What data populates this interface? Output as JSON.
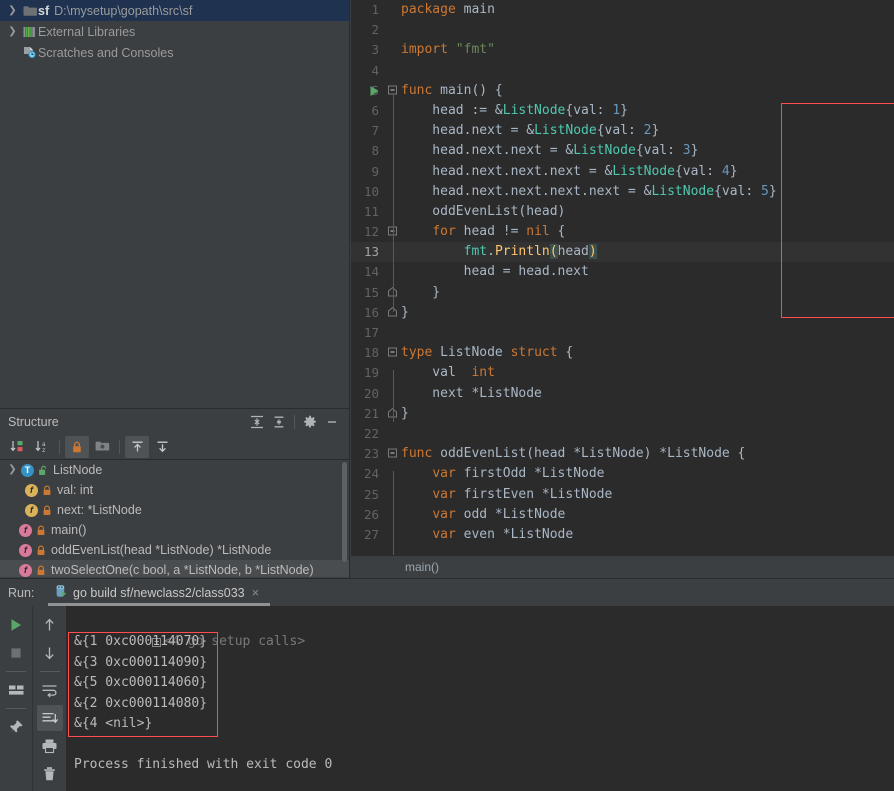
{
  "project_tree": {
    "items": [
      {
        "label_bold": "sf",
        "path": "D:\\mysetup\\gopath\\src\\sf",
        "icon": "folder-icon",
        "arrow": "›",
        "selected": true,
        "indent": 0
      },
      {
        "label_bold": "",
        "path": "External Libraries",
        "icon": "library-icon",
        "arrow": "›",
        "selected": false,
        "indent": 0
      },
      {
        "label_bold": "",
        "path": "Scratches and Consoles",
        "icon": "scratches-icon",
        "arrow": "",
        "selected": false,
        "indent": 0
      }
    ]
  },
  "structure": {
    "title": "Structure",
    "header_buttons": [
      {
        "name": "expand-all-icon"
      },
      {
        "name": "collapse-all-icon"
      },
      {
        "name": "gear-icon"
      },
      {
        "name": "hide-icon"
      }
    ],
    "toolbar_buttons": [
      {
        "name": "sort-by-visibility-icon",
        "active": false
      },
      {
        "name": "sort-alphabetically-icon",
        "active": false
      },
      {
        "name": "show-non-public-icon",
        "active": true
      },
      {
        "name": "group-icon",
        "active": false
      },
      {
        "name": "expand-node-icon",
        "active": true
      },
      {
        "name": "collapse-node-icon",
        "active": false
      }
    ],
    "items": [
      {
        "label": "ListNode",
        "kind": "T",
        "lock": "unlocked",
        "indent": 0,
        "expanded": true
      },
      {
        "label": "val: int",
        "kind": "f",
        "lock": "locked",
        "indent": 1,
        "expanded": null
      },
      {
        "label": "next: *ListNode",
        "kind": "f",
        "lock": "locked",
        "indent": 1,
        "expanded": null
      },
      {
        "label": "main()",
        "kind": "func",
        "lock": "locked",
        "indent": 0,
        "expanded": null
      },
      {
        "label": "oddEvenList(head *ListNode) *ListNode",
        "kind": "func",
        "lock": "locked",
        "indent": 0,
        "expanded": null
      },
      {
        "label": "twoSelectOne(c bool, a *ListNode, b *ListNode)",
        "kind": "func",
        "lock": "locked",
        "indent": 0,
        "expanded": null
      }
    ]
  },
  "editor": {
    "breadcrumb": "main()",
    "highlighted_line": 13,
    "run_arrow_line": 5,
    "lines": [
      {
        "n": 1,
        "tokens": [
          {
            "t": "package",
            "c": "kw"
          },
          {
            "t": " main",
            "c": "ident"
          }
        ]
      },
      {
        "n": 2,
        "tokens": []
      },
      {
        "n": 3,
        "tokens": [
          {
            "t": "import",
            "c": "kw"
          },
          {
            "t": " ",
            "c": "ident"
          },
          {
            "t": "\"fmt\"",
            "c": "str"
          }
        ]
      },
      {
        "n": 4,
        "tokens": []
      },
      {
        "n": 5,
        "tokens": [
          {
            "t": "func",
            "c": "kw"
          },
          {
            "t": " main() {",
            "c": "ident"
          }
        ]
      },
      {
        "n": 6,
        "tokens": [
          {
            "t": "    head := &",
            "c": "ident"
          },
          {
            "t": "ListNode",
            "c": "type"
          },
          {
            "t": "{val: ",
            "c": "ident"
          },
          {
            "t": "1",
            "c": "num"
          },
          {
            "t": "}",
            "c": "ident"
          }
        ]
      },
      {
        "n": 7,
        "tokens": [
          {
            "t": "    head.next = &",
            "c": "ident"
          },
          {
            "t": "ListNode",
            "c": "type"
          },
          {
            "t": "{val: ",
            "c": "ident"
          },
          {
            "t": "2",
            "c": "num"
          },
          {
            "t": "}",
            "c": "ident"
          }
        ]
      },
      {
        "n": 8,
        "tokens": [
          {
            "t": "    head.next.next = &",
            "c": "ident"
          },
          {
            "t": "ListNode",
            "c": "type"
          },
          {
            "t": "{val: ",
            "c": "ident"
          },
          {
            "t": "3",
            "c": "num"
          },
          {
            "t": "}",
            "c": "ident"
          }
        ]
      },
      {
        "n": 9,
        "tokens": [
          {
            "t": "    head.next.next.next = &",
            "c": "ident"
          },
          {
            "t": "ListNode",
            "c": "type"
          },
          {
            "t": "{val: ",
            "c": "ident"
          },
          {
            "t": "4",
            "c": "num"
          },
          {
            "t": "}",
            "c": "ident"
          }
        ]
      },
      {
        "n": 10,
        "tokens": [
          {
            "t": "    head.next.next.next.next = &",
            "c": "ident"
          },
          {
            "t": "ListNode",
            "c": "type"
          },
          {
            "t": "{val: ",
            "c": "ident"
          },
          {
            "t": "5",
            "c": "num"
          },
          {
            "t": "}",
            "c": "ident"
          }
        ]
      },
      {
        "n": 11,
        "tokens": [
          {
            "t": "    oddEvenList(head)",
            "c": "ident"
          }
        ]
      },
      {
        "n": 12,
        "tokens": [
          {
            "t": "    ",
            "c": "ident"
          },
          {
            "t": "for",
            "c": "kw"
          },
          {
            "t": " head != ",
            "c": "ident"
          },
          {
            "t": "nil",
            "c": "kw"
          },
          {
            "t": " {",
            "c": "ident"
          }
        ]
      },
      {
        "n": 13,
        "tokens": [
          {
            "t": "        ",
            "c": "ident"
          },
          {
            "t": "fmt",
            "c": "pkg"
          },
          {
            "t": ".",
            "c": "ident"
          },
          {
            "t": "Println",
            "c": "fn"
          },
          {
            "t": "(",
            "c": "brace-hl"
          },
          {
            "t": "head",
            "c": "ident"
          },
          {
            "t": ")",
            "c": "brace-hl"
          }
        ]
      },
      {
        "n": 14,
        "tokens": [
          {
            "t": "        head = head.next",
            "c": "ident"
          }
        ]
      },
      {
        "n": 15,
        "tokens": [
          {
            "t": "    }",
            "c": "ident"
          }
        ]
      },
      {
        "n": 16,
        "tokens": [
          {
            "t": "}",
            "c": "ident"
          }
        ]
      },
      {
        "n": 17,
        "tokens": []
      },
      {
        "n": 18,
        "tokens": [
          {
            "t": "type",
            "c": "kw"
          },
          {
            "t": " ListNode ",
            "c": "ident"
          },
          {
            "t": "struct",
            "c": "kw"
          },
          {
            "t": " {",
            "c": "ident"
          }
        ]
      },
      {
        "n": 19,
        "tokens": [
          {
            "t": "    val  ",
            "c": "ident"
          },
          {
            "t": "int",
            "c": "kw"
          }
        ]
      },
      {
        "n": 20,
        "tokens": [
          {
            "t": "    next *ListNode",
            "c": "ident"
          }
        ]
      },
      {
        "n": 21,
        "tokens": [
          {
            "t": "}",
            "c": "ident"
          }
        ]
      },
      {
        "n": 22,
        "tokens": []
      },
      {
        "n": 23,
        "tokens": [
          {
            "t": "func",
            "c": "kw"
          },
          {
            "t": " oddEvenList(head *ListNode) *ListNode {",
            "c": "ident"
          }
        ]
      },
      {
        "n": 24,
        "tokens": [
          {
            "t": "    ",
            "c": "ident"
          },
          {
            "t": "var",
            "c": "kw"
          },
          {
            "t": " firstOdd *ListNode",
            "c": "ident"
          }
        ]
      },
      {
        "n": 25,
        "tokens": [
          {
            "t": "    ",
            "c": "ident"
          },
          {
            "t": "var",
            "c": "kw"
          },
          {
            "t": " firstEven *ListNode",
            "c": "ident"
          }
        ]
      },
      {
        "n": 26,
        "tokens": [
          {
            "t": "    ",
            "c": "ident"
          },
          {
            "t": "var",
            "c": "kw"
          },
          {
            "t": " odd *ListNode",
            "c": "ident"
          }
        ]
      },
      {
        "n": 27,
        "tokens": [
          {
            "t": "    ",
            "c": "ident"
          },
          {
            "t": "var",
            "c": "kw"
          },
          {
            "t": " even *ListNode",
            "c": "ident"
          }
        ]
      }
    ]
  },
  "run_panel": {
    "label": "Run:",
    "tab": {
      "title": "go build sf/newclass2/class033",
      "icon": "go-run-icon",
      "close": "×"
    },
    "tools_left": [
      {
        "name": "rerun-icon",
        "active": false
      },
      {
        "name": "stop-icon",
        "active": false
      },
      {
        "name": "layout-icon",
        "active": false
      },
      {
        "name": "pin-icon",
        "active": false
      }
    ],
    "tools_right": [
      {
        "name": "up-arrow-icon",
        "active": false
      },
      {
        "name": "down-arrow-icon",
        "active": false
      },
      {
        "name": "soft-wrap-icon",
        "active": false
      },
      {
        "name": "scroll-to-end-icon",
        "active": true
      },
      {
        "name": "print-icon",
        "active": false
      },
      {
        "name": "trash-icon",
        "active": false
      }
    ],
    "console": {
      "collapsed_frames": "<4 go setup calls>",
      "output_lines": [
        "&{1 0xc000114070}",
        "&{3 0xc000114090}",
        "&{5 0xc000114060}",
        "&{2 0xc000114080}",
        "&{4 <nil>}"
      ],
      "status": "Process finished with exit code 0"
    }
  },
  "colors": {
    "panel_bg": "#3c3f41",
    "editor_bg": "#2b2b2b",
    "selection_blue": "#1f3350",
    "annotation_red": "#ff4d4d",
    "keyword_orange": "#cc7832",
    "string_green": "#6a8759",
    "number_blue": "#6897bb",
    "type_teal": "#4ec9b0",
    "function_yellow": "#ffc66d"
  }
}
